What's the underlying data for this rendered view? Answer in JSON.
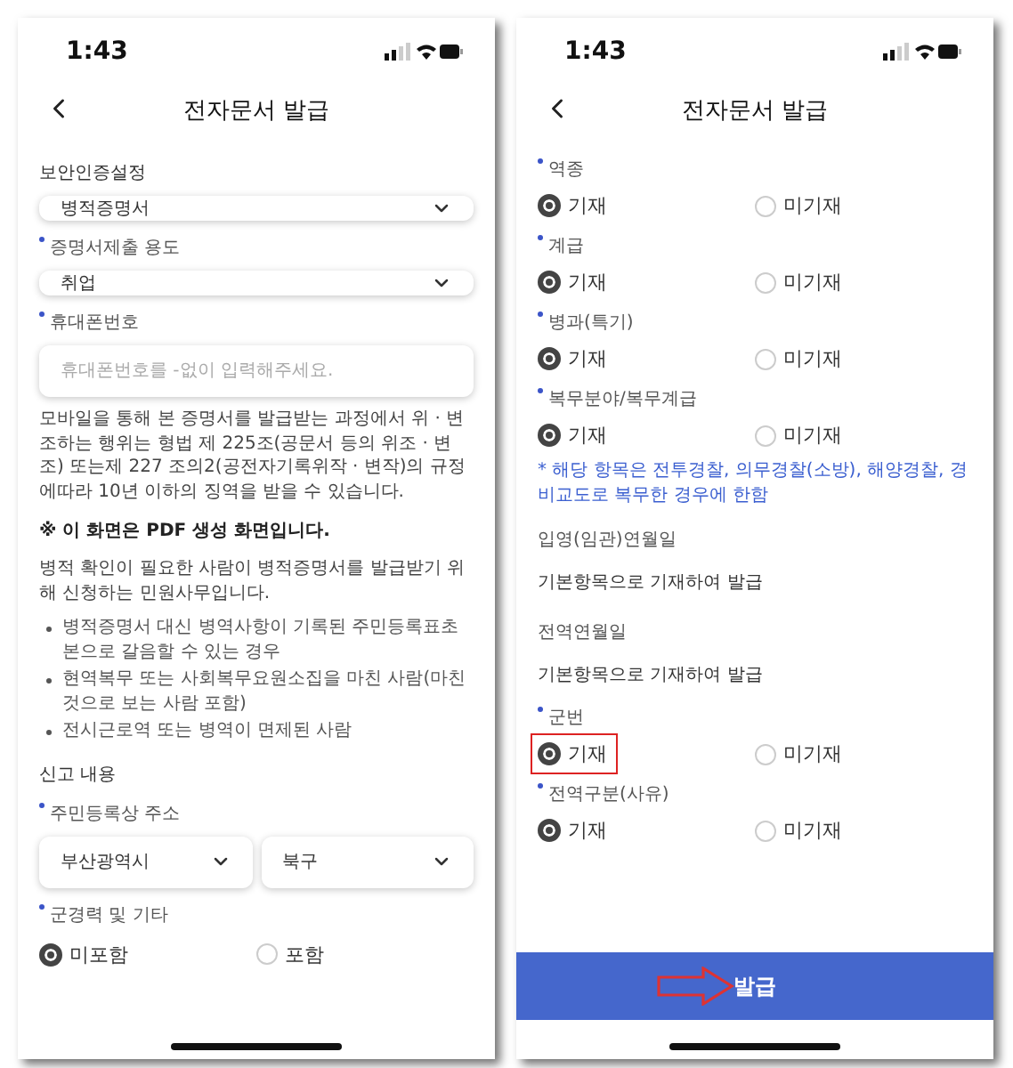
{
  "screens": [
    {
      "time": "1:43",
      "title": "전자문서 발급",
      "items": [
        {
          "kind": "section",
          "text": "보안인증설정"
        },
        {
          "kind": "select",
          "value": "병적증명서"
        },
        {
          "kind": "label",
          "text": "증명서제출 용도",
          "required": true
        },
        {
          "kind": "select",
          "value": "취업"
        },
        {
          "kind": "label",
          "text": "휴대폰번호",
          "required": true
        },
        {
          "kind": "input",
          "placeholder": "휴대폰번호를 -없이 입력해주세요."
        },
        {
          "kind": "paragraph",
          "text": "모바일을 통해 본 증명서를 발급받는 과정에서 위 · 변조하는 행위는 형법 제 225조(공문서 등의 위조 · 변조) 또는제 227 조의2(공전자기록위작 · 변작)의 규정에따라 10년 이하의 징역을 받을 수 있습니다."
        },
        {
          "kind": "notice",
          "text": "※ 이 화면은 PDF 생성 화면입니다."
        },
        {
          "kind": "paragraph",
          "text": "병적 확인이 필요한 사람이 병적증명서를 발급받기 위해 신청하는 민원사무입니다."
        },
        {
          "kind": "bullets",
          "items": [
            "병적증명서 대신 병역사항이 기록된 주민등록표초본으로 갈음할 수 있는 경우",
            "현역복무 또는 사회복무요원소집을 마친 사람(마친 것으로 보는 사람 포함)",
            "전시근로역 또는 병역이 면제된 사람"
          ]
        },
        {
          "kind": "section",
          "text": "신고 내용"
        },
        {
          "kind": "label",
          "text": "주민등록상 주소",
          "required": true
        },
        {
          "kind": "select_pair",
          "values": [
            "부산광역시",
            "북구"
          ]
        },
        {
          "kind": "label",
          "text": "군경력 및 기타",
          "required": true
        },
        {
          "kind": "radio",
          "options": [
            {
              "label": "미포함",
              "selected": true,
              "highlighted": false
            },
            {
              "label": "포함",
              "selected": false,
              "highlighted": false
            }
          ]
        }
      ]
    },
    {
      "time": "1:43",
      "title": "전자문서 발급",
      "button": "발급",
      "items": [
        {
          "kind": "label",
          "text": "역종",
          "required": true
        },
        {
          "kind": "radio",
          "options": [
            {
              "label": "기재",
              "selected": true,
              "highlighted": false
            },
            {
              "label": "미기재",
              "selected": false,
              "highlighted": false
            }
          ]
        },
        {
          "kind": "label",
          "text": "계급",
          "required": true
        },
        {
          "kind": "radio",
          "options": [
            {
              "label": "기재",
              "selected": true,
              "highlighted": false
            },
            {
              "label": "미기재",
              "selected": false,
              "highlighted": false
            }
          ]
        },
        {
          "kind": "label",
          "text": "병과(특기)",
          "required": true
        },
        {
          "kind": "radio",
          "options": [
            {
              "label": "기재",
              "selected": true,
              "highlighted": false
            },
            {
              "label": "미기재",
              "selected": false,
              "highlighted": false
            }
          ]
        },
        {
          "kind": "label",
          "text": "복무분야/복무계급",
          "required": true
        },
        {
          "kind": "radio",
          "options": [
            {
              "label": "기재",
              "selected": true,
              "highlighted": false
            },
            {
              "label": "미기재",
              "selected": false,
              "highlighted": false
            }
          ]
        },
        {
          "kind": "info",
          "text": "* 해당 항목은 전투경찰, 의무경찰(소방), 해양경찰, 경비교도로 복무한 경우에 한함"
        },
        {
          "kind": "readonly",
          "label": "입영(임관)연월일",
          "value": "기본항목으로 기재하여 발급"
        },
        {
          "kind": "readonly",
          "label": "전역연월일",
          "value": "기본항목으로 기재하여 발급"
        },
        {
          "kind": "label",
          "text": "군번",
          "required": true
        },
        {
          "kind": "radio",
          "options": [
            {
              "label": "기재",
              "selected": true,
              "highlighted": true
            },
            {
              "label": "미기재",
              "selected": false,
              "highlighted": false
            }
          ]
        },
        {
          "kind": "label",
          "text": "전역구분(사유)",
          "required": true
        },
        {
          "kind": "radio",
          "options": [
            {
              "label": "기재",
              "selected": true,
              "highlighted": false
            },
            {
              "label": "미기재",
              "selected": false,
              "highlighted": false
            }
          ]
        }
      ]
    }
  ]
}
